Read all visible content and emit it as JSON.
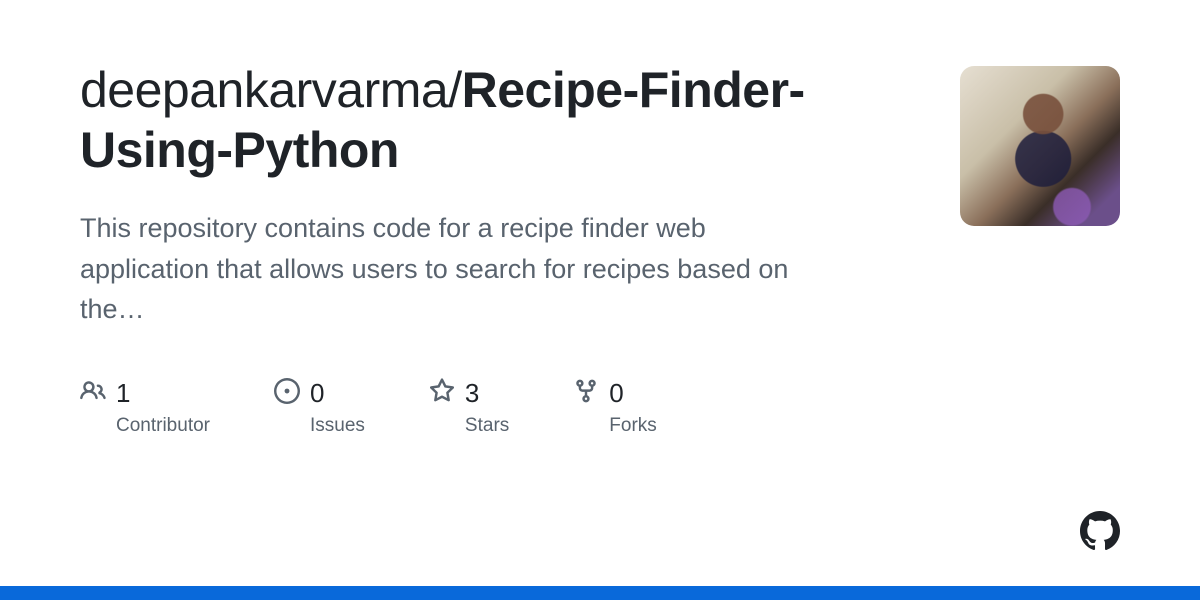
{
  "repo": {
    "owner": "deepankarvarma",
    "separator": "/",
    "name": "Recipe-Finder-Using-Python"
  },
  "description": "This repository contains code for a recipe finder web application that allows users to search for recipes based on the…",
  "stats": {
    "contributors": {
      "value": "1",
      "label": "Contributor"
    },
    "issues": {
      "value": "0",
      "label": "Issues"
    },
    "stars": {
      "value": "3",
      "label": "Stars"
    },
    "forks": {
      "value": "0",
      "label": "Forks"
    }
  },
  "colors": {
    "accent": "#0969da",
    "text": "#1f2328",
    "muted": "#59636e"
  }
}
